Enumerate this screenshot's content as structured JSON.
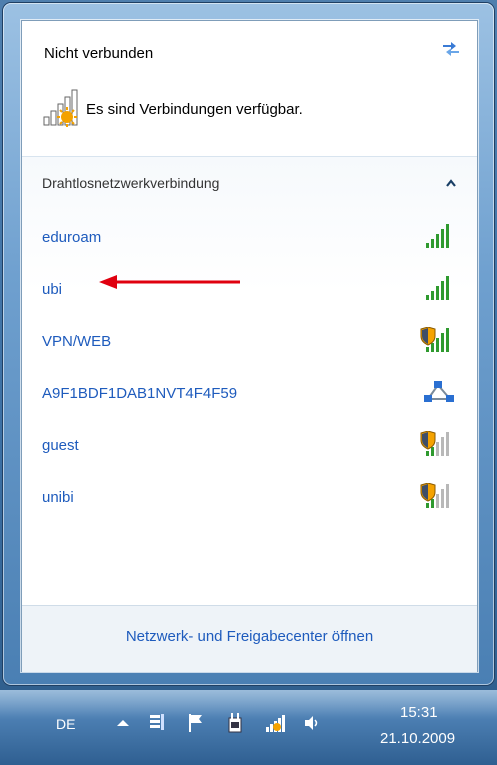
{
  "header": {
    "status": "Nicht verbunden",
    "availability": "Es sind Verbindungen verfügbar.",
    "refresh_icon": "refresh-icon",
    "availability_icon": "network-available-icon"
  },
  "section": {
    "title": "Drahtlosnetzwerkverbindung",
    "collapse_icon": "chevron-up-icon"
  },
  "networks": [
    {
      "name": "eduroam",
      "icon": "signal-full-icon",
      "secured": false,
      "strength": 1.0
    },
    {
      "name": "ubi",
      "icon": "signal-full-icon",
      "secured": false,
      "strength": 1.0
    },
    {
      "name": "VPN/WEB",
      "icon": "signal-secured-icon",
      "secured": true,
      "strength": 1.0
    },
    {
      "name": "A9F1BDF1DAB1NVT4F4F59",
      "icon": "adhoc-network-icon",
      "secured": false,
      "strength": null
    },
    {
      "name": "guest",
      "icon": "signal-secured-weak-icon",
      "secured": true,
      "strength": 0.4
    },
    {
      "name": "unibi",
      "icon": "signal-secured-weak-icon",
      "secured": true,
      "strength": 0.4
    }
  ],
  "annotation": {
    "icon": "red-arrow-icon",
    "color": "#e0000f"
  },
  "footer": {
    "link": "Netzwerk- und Freigabecenter öffnen"
  },
  "taskbar": {
    "language": "DE",
    "time": "15:31",
    "date": "21.10.2009",
    "icons": [
      "show-hidden-icons-arrow",
      "taskbar-app-icon",
      "action-center-flag-icon",
      "power-plug-icon",
      "network-icon",
      "volume-icon"
    ]
  },
  "colors": {
    "link": "#1e5bbd",
    "signal_green": "#2f9a2f",
    "accent_orange": "#f4a200"
  }
}
